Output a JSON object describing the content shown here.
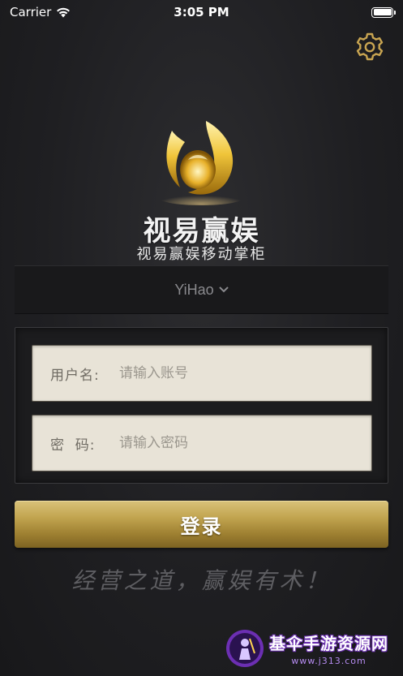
{
  "status_bar": {
    "carrier": "Carrier",
    "time": "3:05 PM"
  },
  "brand": {
    "name": "视易赢娱",
    "subtitle": "视易赢娱移动掌柜"
  },
  "server": {
    "selected": "YiHao"
  },
  "login_form": {
    "username_label": "用户名:",
    "username_placeholder": "请输入账号",
    "password_label": "密  码:",
    "password_placeholder": "请输入密码"
  },
  "login_button_label": "登录",
  "slogan": "经营之道，赢娱有术！",
  "watermark": {
    "title": "基伞手游资源网",
    "url": "www.j313.com"
  },
  "icons": [
    "wifi-icon",
    "battery-icon",
    "gear-icon",
    "flame-logo-icon",
    "chevron-down-icon"
  ],
  "colors": {
    "gold": "#c2a550",
    "background": "#1f1f22",
    "field_bg": "#e8e3d7",
    "watermark_purple": "#6c2fb3"
  }
}
